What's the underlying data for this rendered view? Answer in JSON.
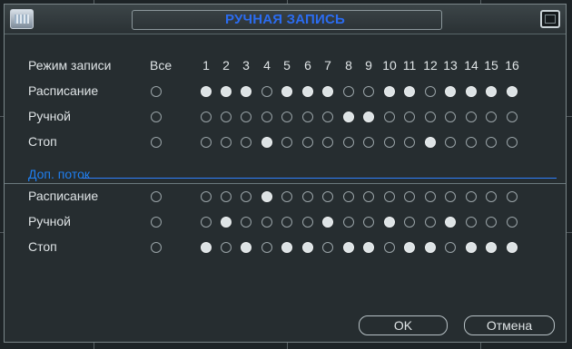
{
  "dialog": {
    "title": "РУЧНАЯ ЗАПИСЬ",
    "icons": {
      "app": "dvr-app-icon",
      "close": "close-icon"
    }
  },
  "header": {
    "mode_label": "Режим записи",
    "all_label": "Все",
    "channels": [
      "1",
      "2",
      "3",
      "4",
      "5",
      "6",
      "7",
      "8",
      "9",
      "10",
      "11",
      "12",
      "13",
      "14",
      "15",
      "16"
    ]
  },
  "main_stream": {
    "rows": [
      {
        "label": "Расписание",
        "all": false,
        "channels": [
          true,
          true,
          true,
          false,
          true,
          true,
          true,
          false,
          false,
          true,
          true,
          false,
          true,
          true,
          true,
          true
        ]
      },
      {
        "label": "Ручной",
        "all": false,
        "channels": [
          false,
          false,
          false,
          false,
          false,
          false,
          false,
          true,
          true,
          false,
          false,
          false,
          false,
          false,
          false,
          false
        ]
      },
      {
        "label": "Стоп",
        "all": false,
        "channels": [
          false,
          false,
          false,
          true,
          false,
          false,
          false,
          false,
          false,
          false,
          false,
          true,
          false,
          false,
          false,
          false
        ]
      }
    ]
  },
  "sub_stream": {
    "title": "Доп. поток",
    "rows": [
      {
        "label": "Расписание",
        "all": false,
        "channels": [
          false,
          false,
          false,
          true,
          false,
          false,
          false,
          false,
          false,
          false,
          false,
          false,
          false,
          false,
          false,
          false
        ]
      },
      {
        "label": "Ручной",
        "all": false,
        "channels": [
          false,
          true,
          false,
          false,
          false,
          false,
          true,
          false,
          false,
          true,
          false,
          false,
          true,
          false,
          false,
          false
        ]
      },
      {
        "label": "Стоп",
        "all": false,
        "channels": [
          true,
          false,
          true,
          false,
          true,
          true,
          false,
          true,
          true,
          false,
          true,
          true,
          false,
          true,
          true,
          true
        ]
      }
    ]
  },
  "buttons": {
    "ok": "OK",
    "cancel": "Отмена"
  },
  "colors": {
    "title": "#2b6cf0",
    "sub_stream_title": "#1f7ff0",
    "selected_dot": "#dde3e5"
  }
}
